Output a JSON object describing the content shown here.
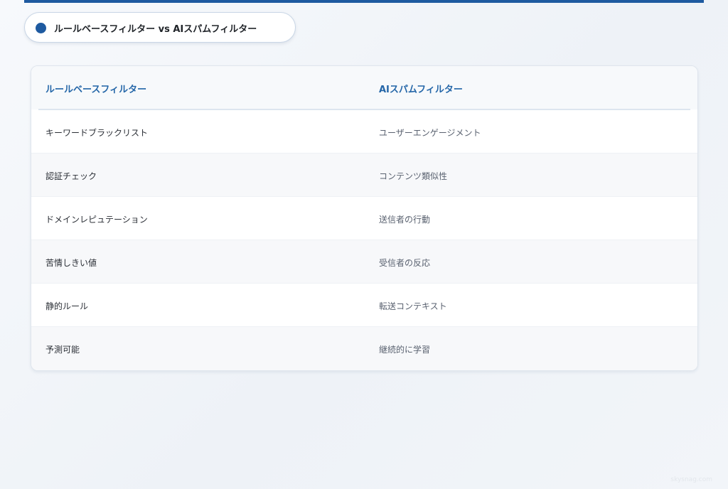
{
  "title": "ルールベースフィルター vs AIスパムフィルター",
  "table": {
    "headers": [
      "ルールベースフィルター",
      "AIスパムフィルター"
    ],
    "rows": [
      [
        "キーワードブラックリスト",
        "ユーザーエンゲージメント"
      ],
      [
        "認証チェック",
        "コンテンツ類似性"
      ],
      [
        "ドメインレピュテーション",
        "送信者の行動"
      ],
      [
        "苦情しきい値",
        "受信者の反応"
      ],
      [
        "静的ルール",
        "転送コンテキスト"
      ],
      [
        "予測可能",
        "継続的に学習"
      ]
    ]
  },
  "watermark": "skysnag.com",
  "colors": {
    "accent": "#1e5aa0",
    "header_text": "#2466a8"
  }
}
